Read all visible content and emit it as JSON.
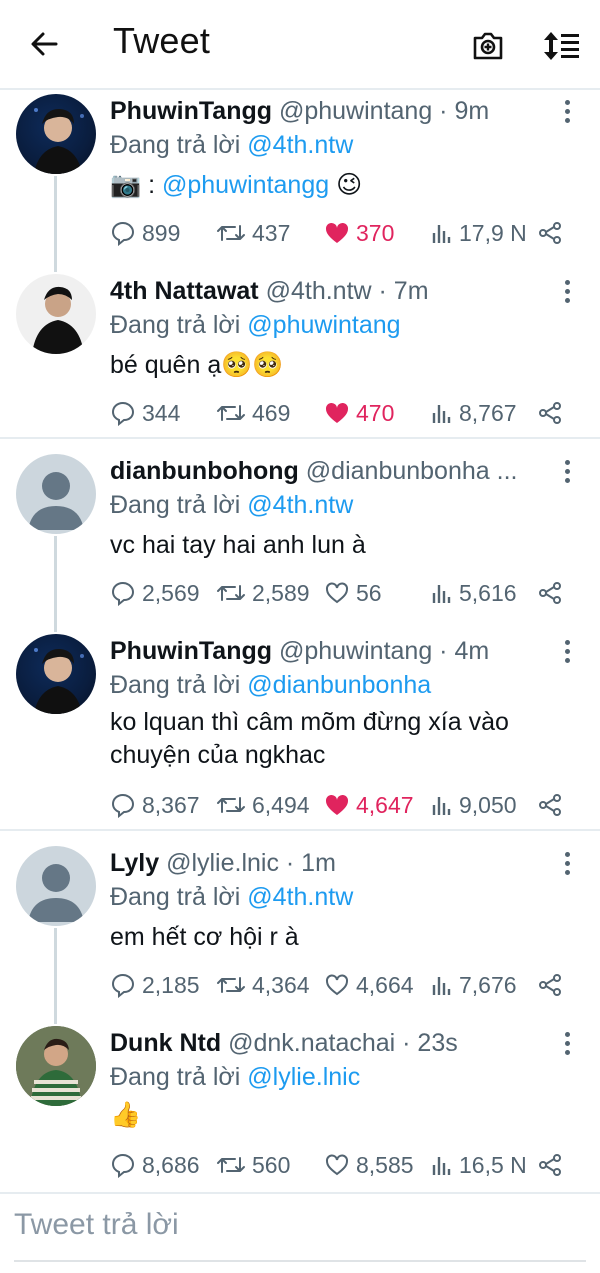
{
  "header": {
    "title": "Tweet",
    "back_icon": "arrow-left-icon",
    "camera_icon": "camera-icon",
    "sort_icon": "sort-icon"
  },
  "tweets": [
    {
      "name": "PhuwinTangg",
      "meta": "@phuwintang · 9m",
      "reply_prefix": "Đang trả lời",
      "reply_to": "@4th.ntw",
      "text_prefix": "📷 : ",
      "text_mention": "@phuwintangg",
      "text_suffix": " 😉",
      "replies": "899",
      "retweets": "437",
      "likes": "370",
      "views": "17,9 N",
      "liked": true
    },
    {
      "name": "4th Nattawat",
      "meta": "@4th.ntw · 7m",
      "reply_prefix": "Đang trả lời",
      "reply_to": "@phuwintang",
      "text": "bé quên ạ🥺🥺",
      "replies": "344",
      "retweets": "469",
      "likes": "470",
      "views": "8,767",
      "liked": true
    },
    {
      "name": "dianbunbohong",
      "meta": "@dianbunbonha ...",
      "reply_prefix": "Đang trả lời",
      "reply_to": "@4th.ntw",
      "text": "vc hai tay hai anh lun à",
      "replies": "2,569",
      "retweets": "2,589",
      "likes": "56",
      "views": "5,616",
      "liked": false
    },
    {
      "name": "PhuwinTangg",
      "meta": "@phuwintang · 4m",
      "reply_prefix": "Đang trả lời",
      "reply_to": "@dianbunbonha",
      "text": "ko lquan thì câm mõm đừng xía vào chuyện của ngkhac",
      "replies": "8,367",
      "retweets": "6,494",
      "likes": "4,647",
      "views": "9,050",
      "liked": true
    },
    {
      "name": "Lyly",
      "meta": "@lylie.lnic · 1m",
      "reply_prefix": "Đang trả lời",
      "reply_to": "@4th.ntw",
      "text": "em hết cơ hội r à",
      "replies": "2,185",
      "retweets": "4,364",
      "likes": "4,664",
      "views": "7,676",
      "liked": false
    },
    {
      "name": "Dunk Ntd",
      "meta": "@dnk.natachai · 23s",
      "reply_prefix": "Đang trả lời",
      "reply_to": "@lylie.lnic",
      "text": "👍",
      "replies": "8,686",
      "retweets": "560",
      "likes": "8,585",
      "views": "16,5 N",
      "liked": false
    }
  ],
  "compose": {
    "placeholder": "Tweet trả lời"
  },
  "colors": {
    "accent": "#1d9bf0",
    "like": "#e0245e",
    "muted": "#536471"
  }
}
